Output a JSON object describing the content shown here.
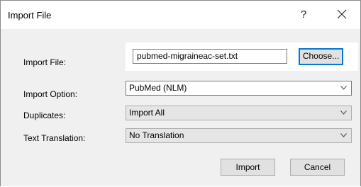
{
  "dialog": {
    "title": "Import File",
    "help_label": "?"
  },
  "fields": {
    "import_file": {
      "label": "Import File:",
      "value": "pubmed-migraineac-set.txt",
      "choose_label": "Choose..."
    },
    "import_option": {
      "label": "Import Option:",
      "value": "PubMed (NLM)"
    },
    "duplicates": {
      "label": "Duplicates:",
      "value": "Import All"
    },
    "text_translation": {
      "label": "Text Translation:",
      "value": "No Translation"
    }
  },
  "buttons": {
    "import_label": "Import",
    "cancel_label": "Cancel"
  },
  "icons": {
    "close": "close-icon",
    "dropdown": "chevron-down-icon"
  },
  "colors": {
    "focus_accent": "#0078d7",
    "dialog_bg": "#f0f0f0"
  }
}
